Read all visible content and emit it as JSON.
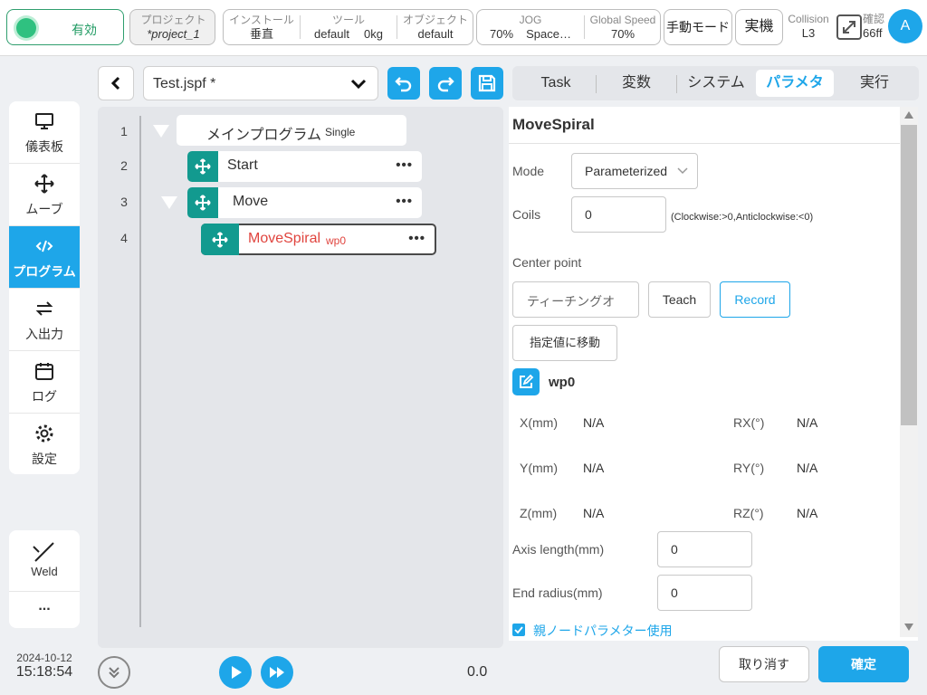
{
  "status": {
    "enable": "有効",
    "project_label": "プロジェクト",
    "project_value": "*project_1",
    "install_label": "インストール",
    "install_value": "垂直",
    "tool_label": "ツール",
    "tool_value": "default",
    "tool_weight": "0kg",
    "object_label": "オブジェクト",
    "object_value": "default",
    "jog_label": "JOG",
    "jog_value": "70%",
    "jog_mode": "Space…",
    "speed_label": "Global Speed",
    "speed_value": "70%",
    "manual_mode": "手動モード",
    "real_machine": "実機",
    "collision_label": "Collision",
    "collision_value": "L3",
    "confirm_label": "確認",
    "confirm_value": "66ff",
    "avatar": "A"
  },
  "nav": {
    "items": [
      {
        "label": "儀表板",
        "icon": "monitor-icon"
      },
      {
        "label": "ムーブ",
        "icon": "move-arrows-icon"
      },
      {
        "label": "プログラム",
        "icon": "code-icon"
      },
      {
        "label": "入出力",
        "icon": "io-swap-icon"
      },
      {
        "label": "ログ",
        "icon": "calendar-icon"
      },
      {
        "label": "設定",
        "icon": "gear-icon"
      }
    ],
    "active_index": 2,
    "weld_label": "Weld",
    "more_label": "..."
  },
  "datetime": {
    "date": "2024-10-12",
    "time": "15:18:54"
  },
  "program": {
    "file_name": "Test.jspf *",
    "lines": [
      "1",
      "2",
      "3",
      "4"
    ],
    "main_title": "メインプログラム",
    "main_mode": "Single",
    "nodes": [
      {
        "name": "Start",
        "suffix": ""
      },
      {
        "name": "Move",
        "suffix": ""
      },
      {
        "name": "MoveSpiral",
        "suffix": "wp0"
      }
    ],
    "progress_value": "0.0"
  },
  "tabs": [
    "Task",
    "変数",
    "システム",
    "パラメタ",
    "実行"
  ],
  "params": {
    "title": "MoveSpiral",
    "mode_label": "Mode",
    "mode_value": "Parameterized",
    "coils_label": "Coils",
    "coils_value": "0",
    "coils_hint": "(Clockwise:>0,Anticlockwise:<0)",
    "center_label": "Center point",
    "teach_select": "ティーチングオ",
    "teach_btn": "Teach",
    "record_btn": "Record",
    "move_to_btn": "指定値に移動",
    "waypoint": "wp0",
    "coords": [
      {
        "label": "X(mm)",
        "value": "N/A"
      },
      {
        "label": "RX(°)",
        "value": "N/A"
      },
      {
        "label": "Y(mm)",
        "value": "N/A"
      },
      {
        "label": "RY(°)",
        "value": "N/A"
      },
      {
        "label": "Z(mm)",
        "value": "N/A"
      },
      {
        "label": "RZ(°)",
        "value": "N/A"
      }
    ],
    "axis_label": "Axis length(mm)",
    "axis_value": "0",
    "end_radius_label": "End radius(mm)",
    "end_radius_value": "0",
    "parent_param_label": "親ノードパラメター使用",
    "cancel_btn": "取り消す",
    "confirm_btn": "確定"
  },
  "colors": {
    "accent": "#1ea6e9",
    "teal": "#129a8f",
    "error_red": "#e0443e"
  }
}
